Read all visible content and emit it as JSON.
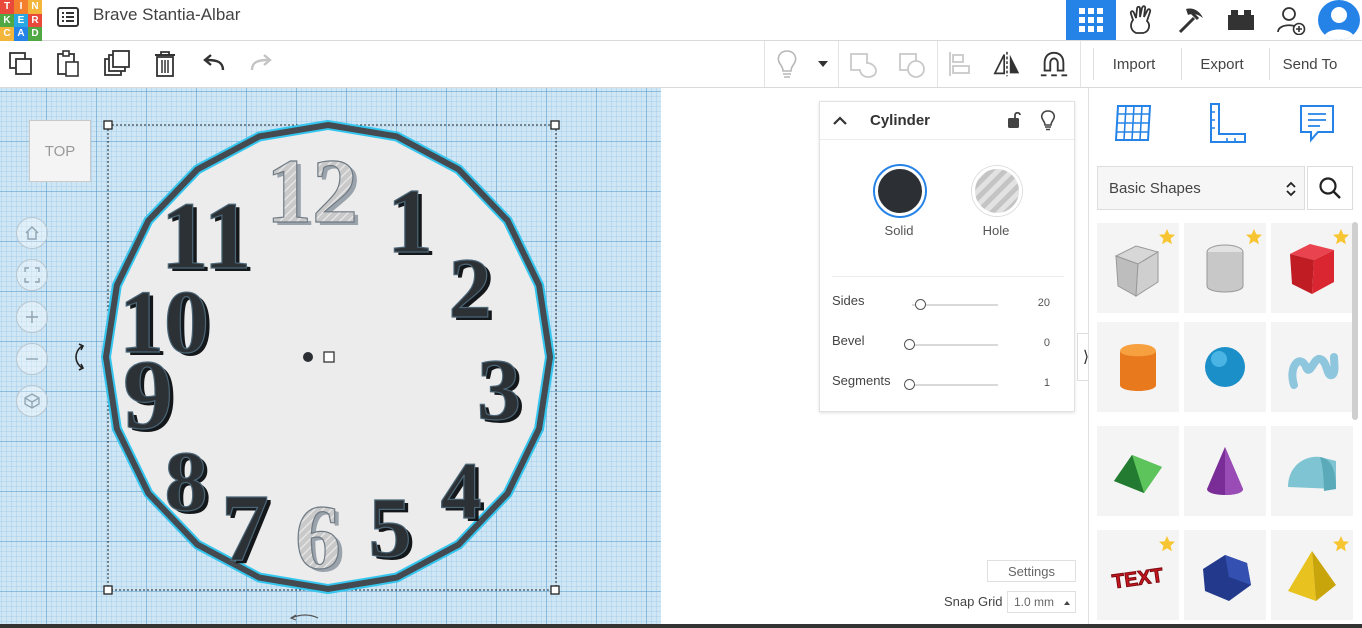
{
  "app": {
    "logo_letters": [
      "T",
      "I",
      "N",
      "K",
      "E",
      "R",
      "C",
      "A",
      "D"
    ],
    "logo_colors": [
      "#e8493b",
      "#f47f2c",
      "#f4b63a",
      "#4fa844",
      "#28a8e0",
      "#e8493b",
      "#f4b63a",
      "#2583e8",
      "#4fa844"
    ],
    "design_title": "Brave Stantia-Albar",
    "accent_color": "#2583e8"
  },
  "header": {
    "view_buttons": [
      {
        "name": "3d-design-icon",
        "active": true
      },
      {
        "name": "codeblocks-icon",
        "active": false
      },
      {
        "name": "tinker-pickaxe-icon",
        "active": false
      },
      {
        "name": "bricks-icon",
        "active": false
      },
      {
        "name": "add-user-icon",
        "active": false
      }
    ]
  },
  "toolbar": {
    "import_label": "Import",
    "export_label": "Export",
    "send_to_label": "Send To"
  },
  "workplane": {
    "viewcube_label": "TOP",
    "clock_numbers": [
      "12",
      "1",
      "2",
      "3",
      "4",
      "5",
      "6",
      "7",
      "8",
      "9",
      "10",
      "11"
    ],
    "hole_numbers": [
      "12",
      "6"
    ]
  },
  "inspector": {
    "shape_name": "Cylinder",
    "solid_label": "Solid",
    "hole_label": "Hole",
    "props": [
      {
        "label": "Sides",
        "value": "20",
        "fraction": 0.13
      },
      {
        "label": "Bevel",
        "value": "0",
        "fraction": 0.0
      },
      {
        "label": "Segments",
        "value": "1",
        "fraction": 0.0
      }
    ]
  },
  "footer": {
    "settings_label": "Settings",
    "snap_grid_label": "Snap Grid",
    "snap_grid_value": "1.0 mm"
  },
  "shapes_panel": {
    "category": "Basic Shapes",
    "tiles": [
      {
        "name": "box-hole-shape",
        "starred": true
      },
      {
        "name": "cylinder-hole-shape",
        "starred": true
      },
      {
        "name": "red-box-shape",
        "starred": true
      },
      {
        "name": "orange-cylinder-shape",
        "starred": false
      },
      {
        "name": "blue-sphere-shape",
        "starred": false
      },
      {
        "name": "scribble-shape",
        "starred": false
      },
      {
        "name": "green-roof-shape",
        "starred": false
      },
      {
        "name": "purple-cone-shape",
        "starred": false
      },
      {
        "name": "round-roof-shape",
        "starred": false
      },
      {
        "name": "red-text-shape",
        "starred": true
      },
      {
        "name": "navy-polygon-shape",
        "starred": false
      },
      {
        "name": "yellow-pyramid-shape",
        "starred": true
      }
    ],
    "text_tile_label": "TEXT"
  }
}
